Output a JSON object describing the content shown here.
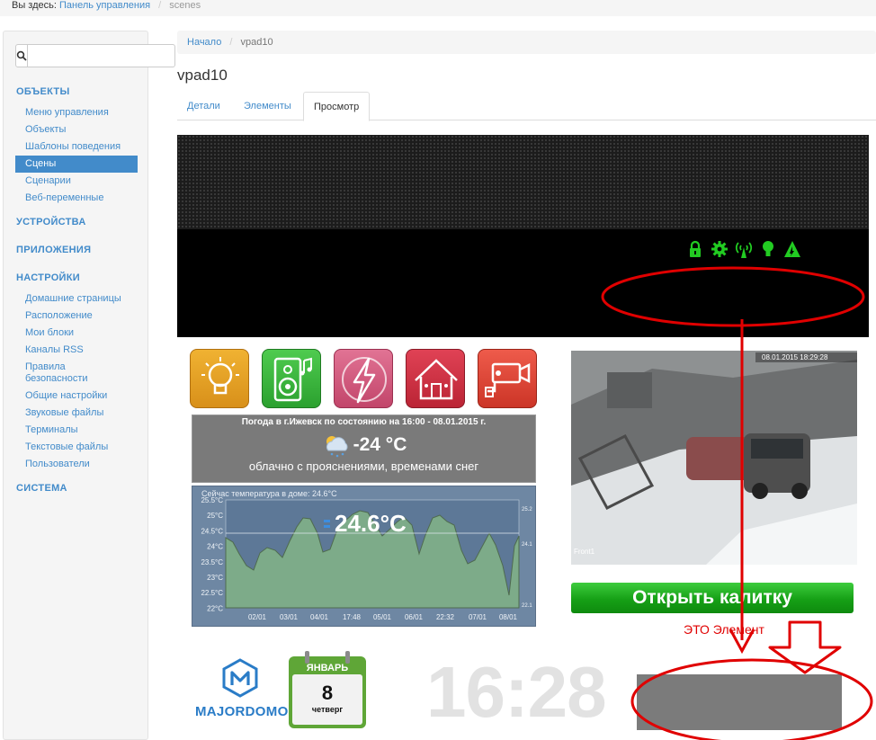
{
  "topbar": {
    "prefix": "Вы здесь:",
    "link": "Панель управления",
    "current": "scenes"
  },
  "sidebar": {
    "search_placeholder": "",
    "sections": [
      {
        "title": "ОБЪЕКТЫ",
        "items": [
          "Меню управления",
          "Объекты",
          "Шаблоны поведения",
          "Сцены",
          "Сценарии",
          "Веб-переменные"
        ],
        "active": "Сцены"
      },
      {
        "title": "УСТРОЙСТВА",
        "items": []
      },
      {
        "title": "ПРИЛОЖЕНИЯ",
        "items": []
      },
      {
        "title": "НАСТРОЙКИ",
        "items": [
          "Домашние страницы",
          "Расположение",
          "Мои блоки",
          "Каналы RSS",
          "Правила безопасности",
          "Общие настройки",
          "Звуковые файлы",
          "Терминалы",
          "Текстовые файлы",
          "Пользователи"
        ]
      },
      {
        "title": "СИСТЕМА",
        "items": []
      }
    ]
  },
  "breadcrumb": {
    "home": "Начало",
    "current": "vpad10"
  },
  "page_title": "vpad10",
  "tabs": [
    {
      "label": "Детали"
    },
    {
      "label": "Элементы"
    },
    {
      "label": "Просмотр",
      "active": true
    }
  ],
  "scene": {
    "status_icons": [
      "lock-icon",
      "gear-icon",
      "antenna-icon",
      "bulb-icon",
      "alert-triangle-icon"
    ],
    "tiles": [
      {
        "name": "light-tile",
        "icon": "bulb-icon",
        "color": "#e8a21a"
      },
      {
        "name": "audio-tile",
        "icon": "speaker-icon",
        "color": "#3cb545"
      },
      {
        "name": "power-tile",
        "icon": "lightning-icon",
        "color": "#d4537e"
      },
      {
        "name": "home-tile",
        "icon": "house-icon",
        "color": "#d0303f"
      },
      {
        "name": "camera-tile",
        "icon": "cctv-icon",
        "color": "#e0473a"
      }
    ],
    "weather": {
      "header": "Погода в г.Ижевск по состоянию на 16:00 - 08.01.2015 г.",
      "temp": "-24 °C",
      "desc": "облачно с прояснениями, временами снег"
    },
    "graph": {
      "caption": "Сейчас температура в доме: 24.6°C",
      "current": "24.6°C",
      "y_ticks": [
        "25.5°C",
        "25°C",
        "24.5°C",
        "24°C",
        "23.5°C",
        "23°C",
        "22.5°C",
        "22°C"
      ],
      "x_ticks": [
        "02/01",
        "03/01",
        "04/01",
        "17:48",
        "05/01",
        "06/01",
        "22:32",
        "07/01",
        "08/01"
      ],
      "right_ticks": [
        "25.2",
        "24.1",
        "22.1"
      ]
    },
    "camera": {
      "timestamp": "08.01.2015 18:29:28",
      "label": "Front1"
    },
    "open_button": "Открыть калитку",
    "annotation": "ЭТО Элемент",
    "logo_text": "MAJORDOMO",
    "calendar": {
      "month": "ЯНВАРЬ",
      "day": "8",
      "weekday": "четверг"
    },
    "clock": "16:28",
    "colors": {
      "accent": "#428bca",
      "annotation": "#e00000",
      "button_green": "#16a016"
    }
  }
}
